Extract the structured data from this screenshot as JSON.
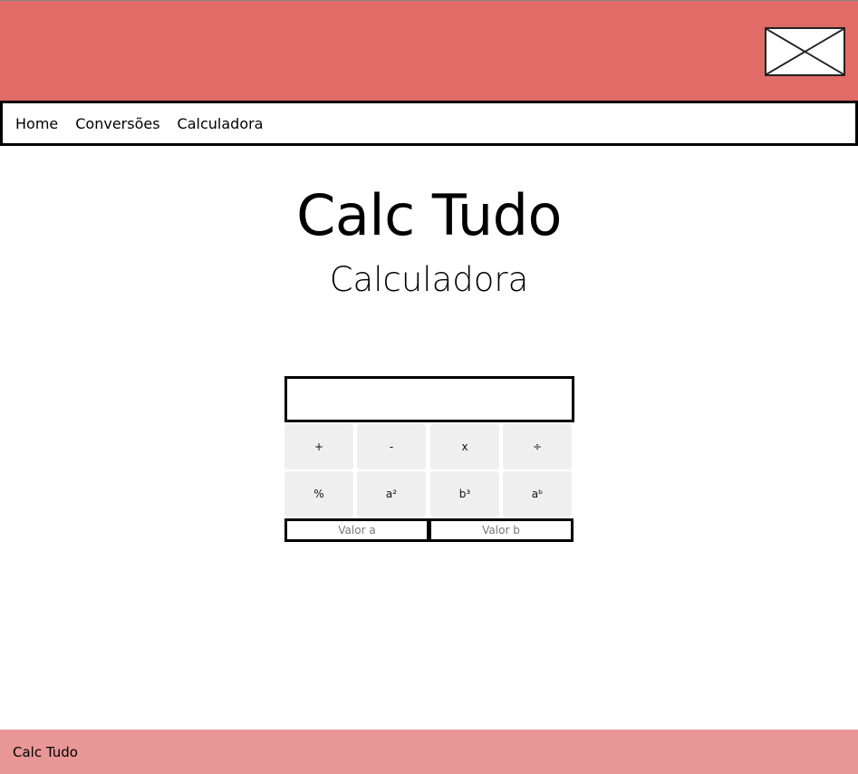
{
  "colors": {
    "header_bg": "#e06b67",
    "footer_bg": "#e89796",
    "key_bg": "#efefef"
  },
  "header": {
    "logo_icon": "image-placeholder-icon"
  },
  "nav": {
    "items": [
      {
        "label": "Home"
      },
      {
        "label": "Conversões"
      },
      {
        "label": "Calculadora"
      }
    ]
  },
  "main": {
    "title": "Calc Tudo",
    "subtitle": "Calculadora"
  },
  "calculator": {
    "display_value": "",
    "keys": [
      {
        "label": "+"
      },
      {
        "label": "-"
      },
      {
        "label": "x"
      },
      {
        "label": "÷"
      },
      {
        "label": "%"
      },
      {
        "label": "a²"
      },
      {
        "label": "b³"
      },
      {
        "label": "aᵇ"
      }
    ],
    "input_a": {
      "value": "",
      "placeholder": "Valor a"
    },
    "input_b": {
      "value": "",
      "placeholder": "Valor b"
    }
  },
  "footer": {
    "text": "Calc Tudo"
  }
}
